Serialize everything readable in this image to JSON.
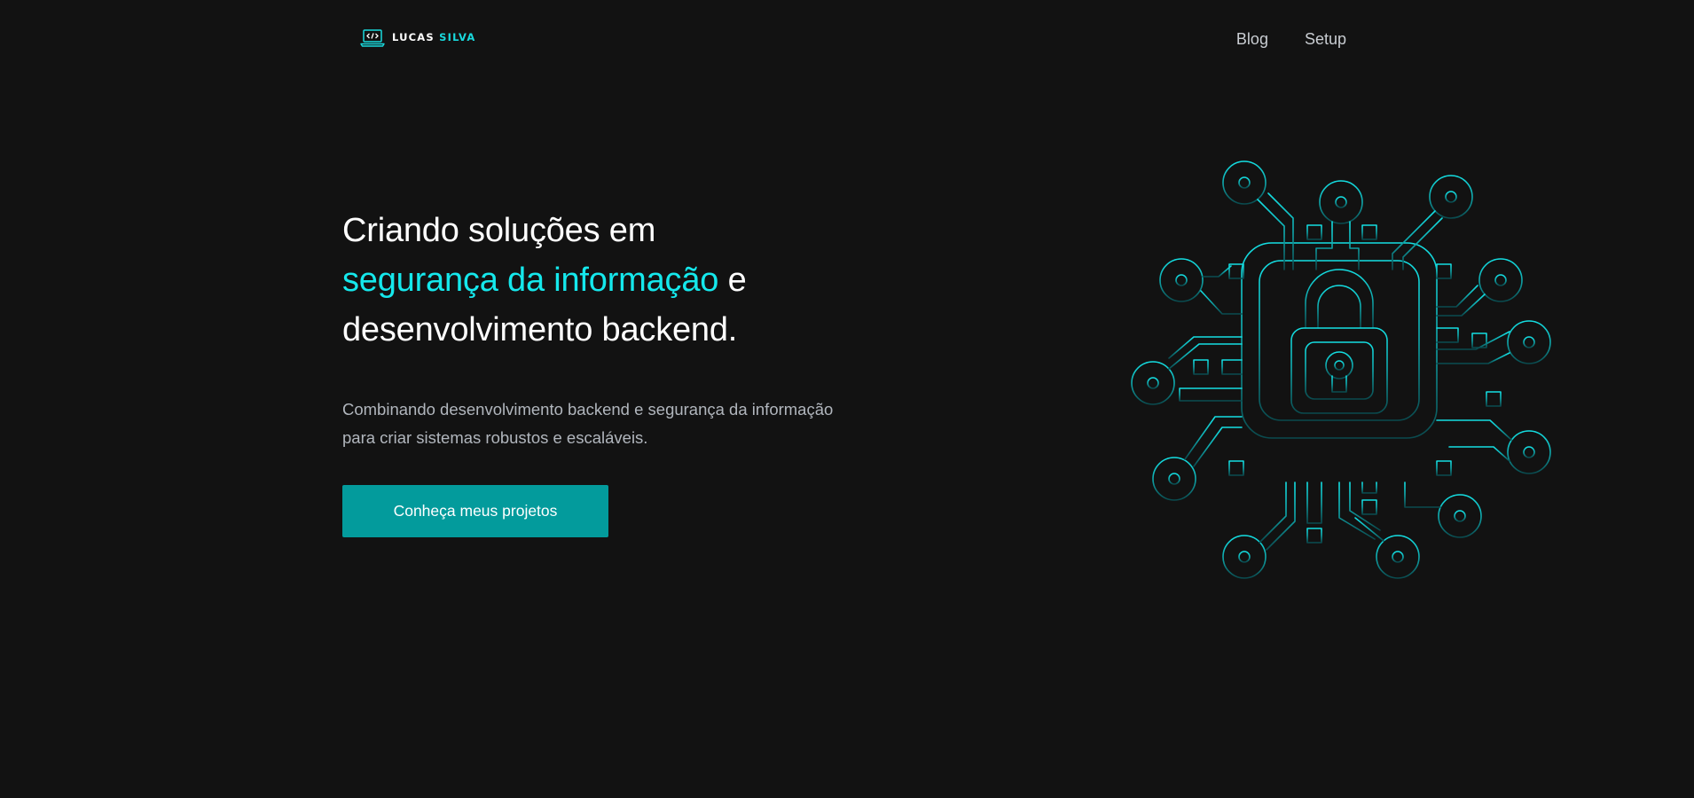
{
  "header": {
    "logo": {
      "first": "LUCAS",
      "last": "SILVA",
      "icon": "laptop-code-icon"
    },
    "nav": [
      {
        "label": "Blog"
      },
      {
        "label": "Setup"
      }
    ]
  },
  "hero": {
    "title_line1": "Criando soluções em",
    "title_highlight": "segurança da informação",
    "title_after_highlight": " e",
    "title_line3": "desenvolvimento backend.",
    "subtitle_line1": "Combinando desenvolvimento backend e segurança da informação",
    "subtitle_line2": "para criar sistemas robustos e escaláveis.",
    "cta_label": "Conheça meus projetos"
  },
  "illustration": {
    "icon": "circuit-lock-icon"
  },
  "colors": {
    "background": "#121212",
    "accent": "#15e8ec",
    "button": "#039b9c",
    "text_muted": "#b1b6bd",
    "nav_text": "#c9cdd2"
  }
}
